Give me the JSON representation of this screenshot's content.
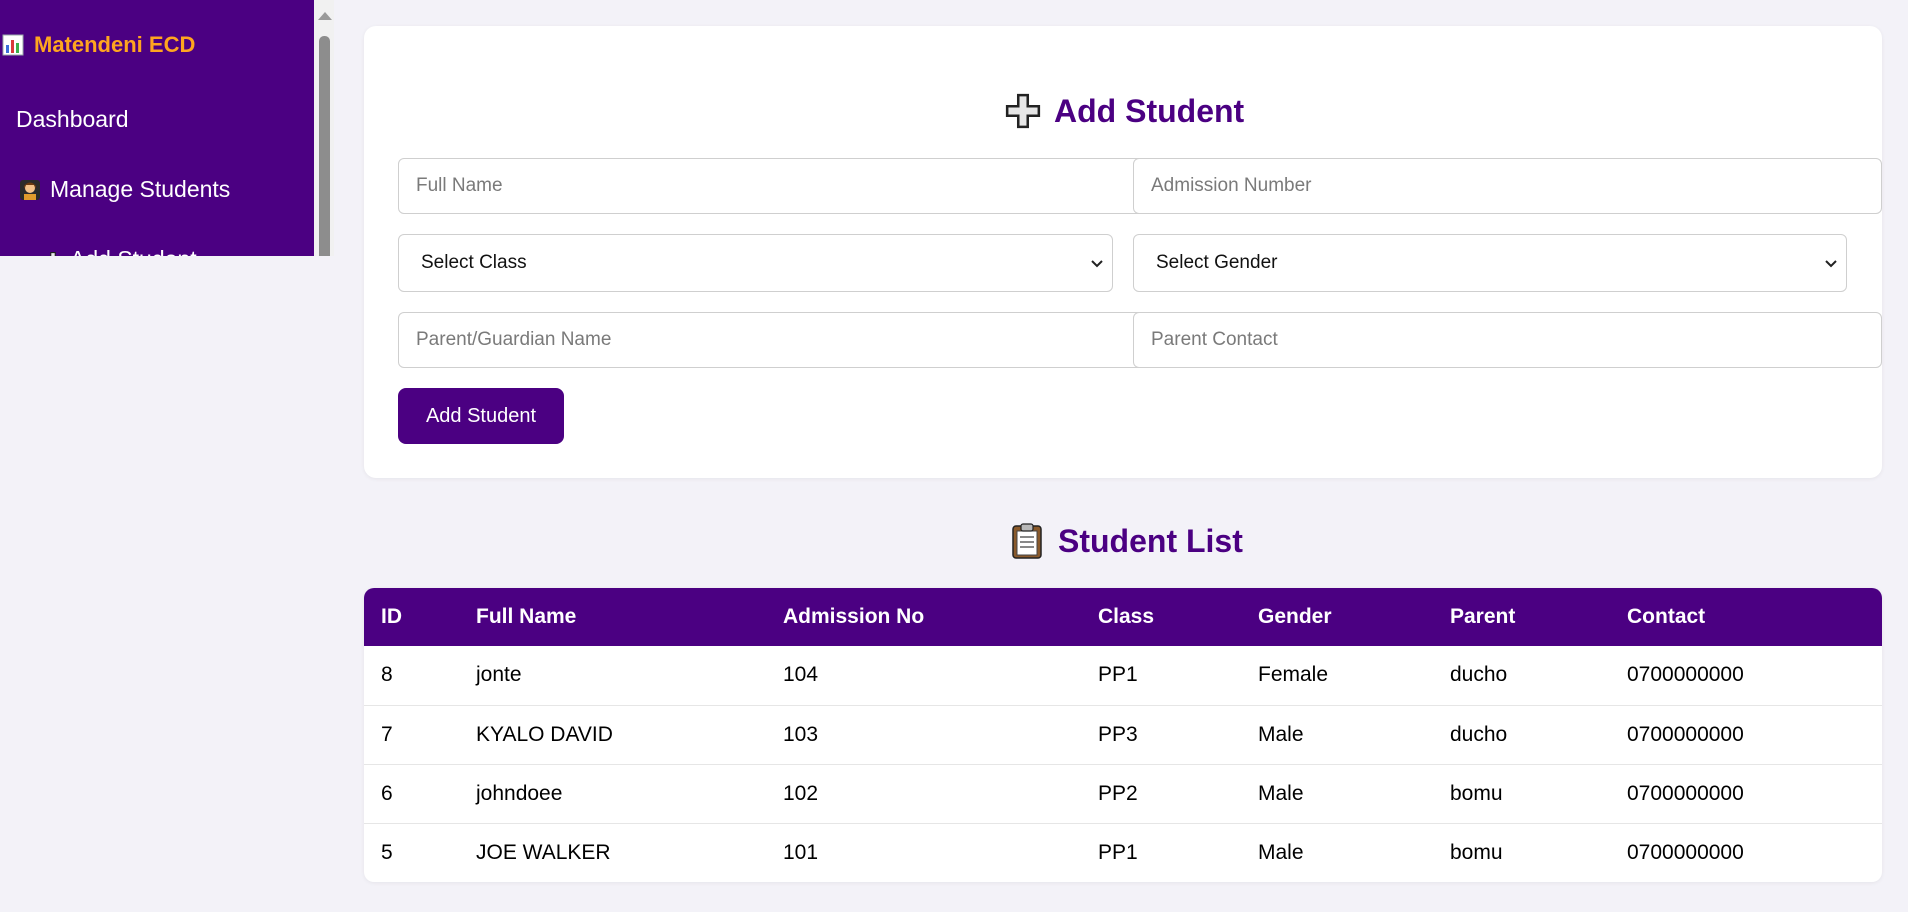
{
  "sidebar": {
    "brand": "Matendeni ECD",
    "items": [
      {
        "label": "Dashboard"
      },
      {
        "label": "Manage Students"
      },
      {
        "label": "Add Student"
      }
    ]
  },
  "form": {
    "title": "Add Student",
    "full_name_placeholder": "Full Name",
    "admission_placeholder": "Admission Number",
    "class_select": "Select Class",
    "gender_select": "Select Gender",
    "parent_placeholder": "Parent/Guardian Name",
    "contact_placeholder": "Parent Contact",
    "submit_label": "Add Student"
  },
  "student_list": {
    "title": "Student List",
    "columns": [
      "ID",
      "Full Name",
      "Admission No",
      "Class",
      "Gender",
      "Parent",
      "Contact"
    ],
    "rows": [
      [
        "8",
        "jonte",
        "104",
        "PP1",
        "Female",
        "ducho",
        "0700000000"
      ],
      [
        "7",
        "KYALO DAVID",
        "103",
        "PP3",
        "Male",
        "ducho",
        "0700000000"
      ],
      [
        "6",
        "johndoee",
        "102",
        "PP2",
        "Male",
        "bomu",
        "0700000000"
      ],
      [
        "5",
        "JOE WALKER",
        "101",
        "PP1",
        "Male",
        "bomu",
        "0700000000"
      ]
    ]
  },
  "colors": {
    "primary": "#4b0082",
    "brand_text": "#ffa51f",
    "background": "#f3f2f8"
  },
  "icons": {
    "brand": "bar-chart-icon",
    "manage_students": "student-icon",
    "add_student": "plus-icon",
    "student_list": "clipboard-icon"
  }
}
